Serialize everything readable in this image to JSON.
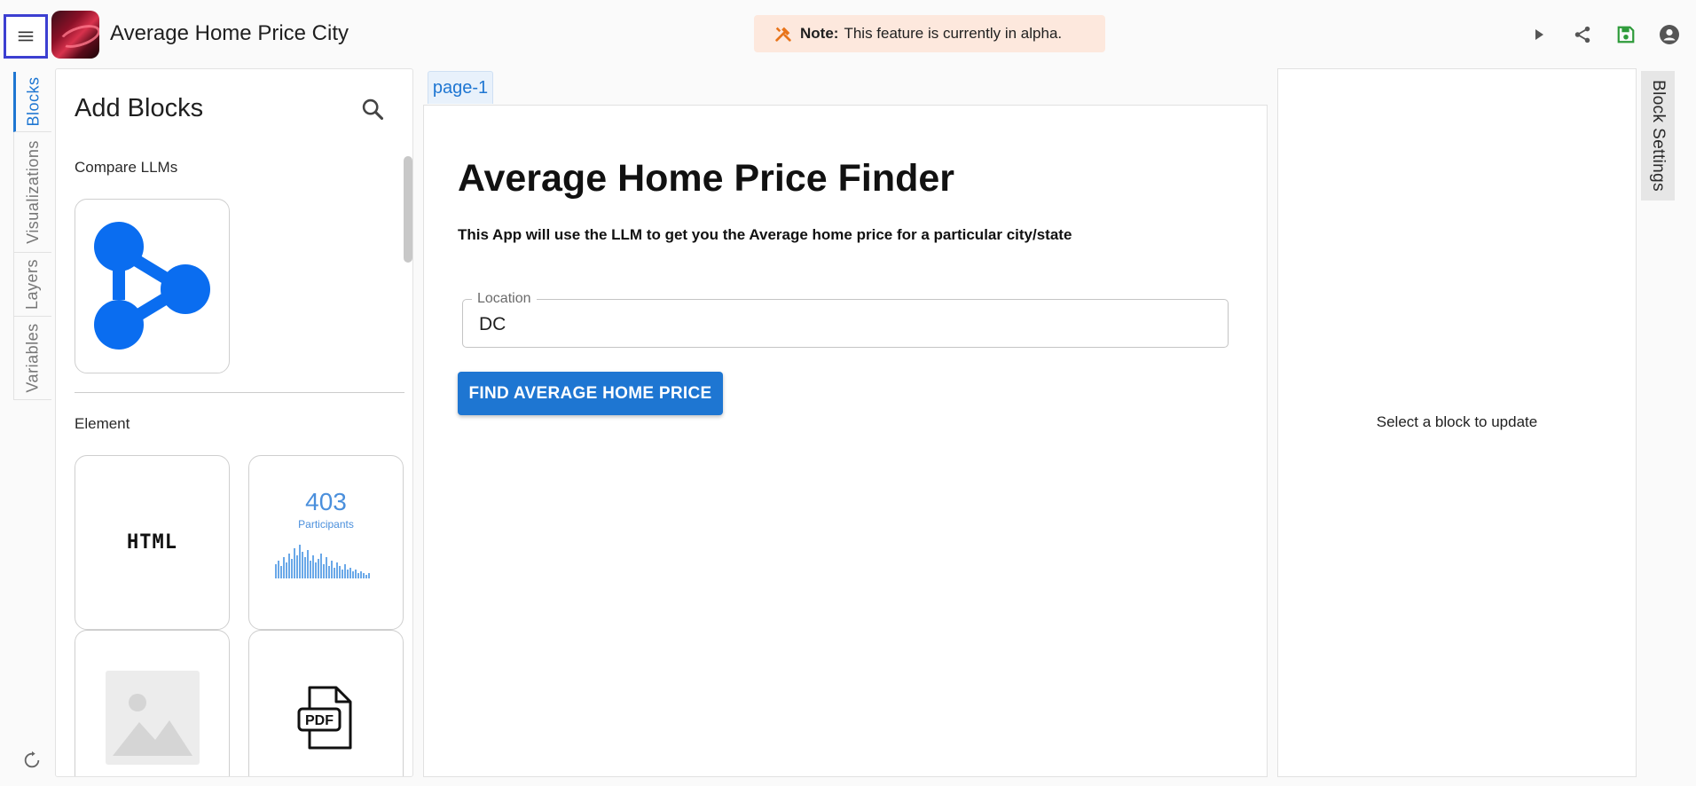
{
  "app": {
    "title": "Average Home Price City"
  },
  "note": {
    "label": "Note:",
    "text": "This feature is currently in alpha."
  },
  "toolbar": {
    "icons": [
      "play-icon",
      "share-icon",
      "save-icon",
      "account-icon"
    ]
  },
  "left_tabs": [
    "Blocks",
    "Visualizations",
    "Layers",
    "Variables"
  ],
  "blocks_panel": {
    "title": "Add Blocks",
    "sections": [
      {
        "label": "Compare LLMs"
      },
      {
        "label": "Element"
      }
    ],
    "tiles": {
      "html_label": "HTML",
      "kpi_value": "403",
      "kpi_caption": "Participants",
      "pdf_label": "PDF"
    }
  },
  "page": {
    "tab": "page-1",
    "heading": "Average Home Price Finder",
    "description": "This App will use the LLM to get you the Average home price for a particular city/state",
    "location": {
      "label": "Location",
      "value": "DC"
    },
    "button": "FIND AVERAGE HOME PRICE"
  },
  "settings": {
    "tab": "Block Settings",
    "empty": "Select a block to update"
  },
  "colors": {
    "accent": "#1e76d2",
    "note_bg": "#fde8dd",
    "save_green": "#2e9b3a",
    "llm_blue": "#0a6df0"
  }
}
